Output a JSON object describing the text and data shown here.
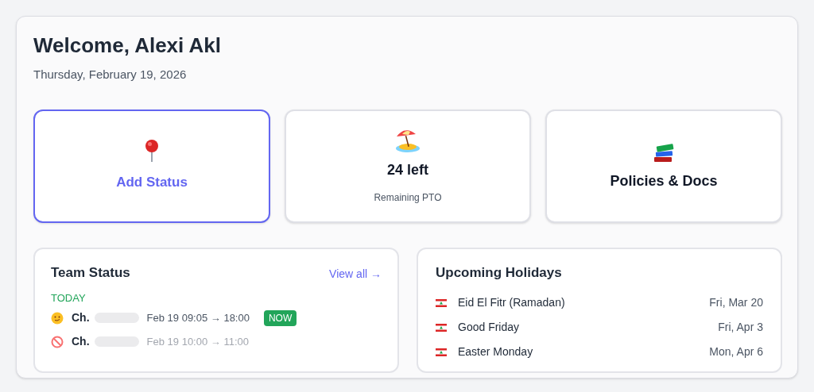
{
  "header": {
    "title": "Welcome, Alexi Akl",
    "date": "Thursday, February 19, 2026"
  },
  "tiles": [
    {
      "kind": "action",
      "label": "Add Status",
      "selected": true
    },
    {
      "kind": "stat",
      "label": "24 left",
      "caption": "Remaining PTO",
      "selected": false
    },
    {
      "kind": "link",
      "label": "Policies & Docs",
      "selected": false
    }
  ],
  "team_status": {
    "title": "Team Status",
    "link": "View all →",
    "section": "TODAY",
    "rows": [
      {
        "kind": "smiley",
        "name": "Ch.",
        "time": "Feb 19 09:05 → 18:00",
        "current": true,
        "badge": "NOW"
      },
      {
        "kind": "blocked",
        "name": "Ch.",
        "time": "Feb 19 10:00 → 11:00",
        "current": false
      }
    ]
  },
  "holidays": {
    "title": "Upcoming Holidays",
    "rows": [
      {
        "name": "Eid El Fitr (Ramadan)",
        "date": "Fri, Mar 20"
      },
      {
        "name": "Good Friday",
        "date": "Fri, Apr 3"
      },
      {
        "name": "Easter Monday",
        "date": "Mon, Apr 6"
      }
    ]
  }
}
